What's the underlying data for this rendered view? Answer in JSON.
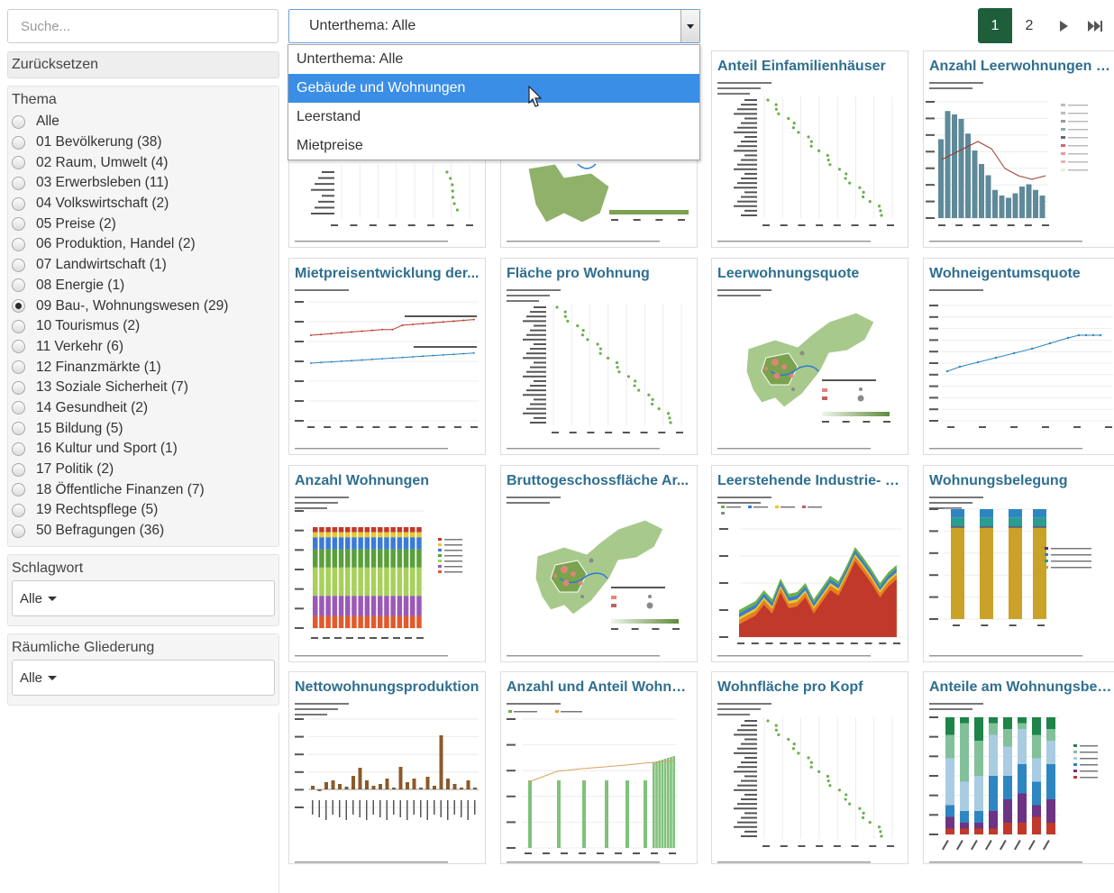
{
  "search": {
    "placeholder": "Suche..."
  },
  "reset_label": "Zurücksetzen",
  "thema": {
    "title": "Thema",
    "options": [
      {
        "label": "Alle",
        "checked": false
      },
      {
        "label": "01 Bevölkerung (38)",
        "checked": false
      },
      {
        "label": "02 Raum, Umwelt (4)",
        "checked": false
      },
      {
        "label": "03 Erwerbsleben (11)",
        "checked": false
      },
      {
        "label": "04 Volkswirtschaft (2)",
        "checked": false
      },
      {
        "label": "05 Preise (2)",
        "checked": false
      },
      {
        "label": "06 Produktion, Handel (2)",
        "checked": false
      },
      {
        "label": "07 Landwirtschaft (1)",
        "checked": false
      },
      {
        "label": "08 Energie (1)",
        "checked": false
      },
      {
        "label": "09 Bau-, Wohnungswesen (29)",
        "checked": true
      },
      {
        "label": "10 Tourismus (2)",
        "checked": false
      },
      {
        "label": "11 Verkehr (6)",
        "checked": false
      },
      {
        "label": "12 Finanzmärkte (1)",
        "checked": false
      },
      {
        "label": "13 Soziale Sicherheit (7)",
        "checked": false
      },
      {
        "label": "14 Gesundheit (2)",
        "checked": false
      },
      {
        "label": "15 Bildung (5)",
        "checked": false
      },
      {
        "label": "16 Kultur und Sport (1)",
        "checked": false
      },
      {
        "label": "17 Politik (2)",
        "checked": false
      },
      {
        "label": "18 Öffentliche Finanzen (7)",
        "checked": false
      },
      {
        "label": "19 Rechtspflege (5)",
        "checked": false
      },
      {
        "label": "50 Befragungen (36)",
        "checked": false
      }
    ]
  },
  "schlagwort": {
    "title": "Schlagwort",
    "value": "Alle"
  },
  "raeumlich": {
    "title": "Räumliche Gliederung",
    "value": "Alle"
  },
  "subthema": {
    "value": "Unterthema: Alle",
    "options": [
      "Unterthema: Alle",
      "Gebäude und Wohnungen",
      "Leerstand",
      "Mietpreise"
    ],
    "highlighted": "Gebäude und Wohnungen"
  },
  "pagination": {
    "pages": [
      "1",
      "2"
    ],
    "current": "1",
    "next": "▶",
    "last": "⏭"
  },
  "cards": [
    {
      "title": "",
      "kind": "dotplot-partial"
    },
    {
      "title": "",
      "kind": "map-partial"
    },
    {
      "title": "Anteil Einfamilienhäuser",
      "kind": "dotplot"
    },
    {
      "title": "Anzahl Leerwohnungen u...",
      "kind": "bar-line"
    },
    {
      "title": "Mietpreisentwicklung der...",
      "kind": "two-lines"
    },
    {
      "title": "Fläche pro Wohnung",
      "kind": "dotplot"
    },
    {
      "title": "Leerwohnungsquote",
      "kind": "map"
    },
    {
      "title": "Wohneigentumsquote",
      "kind": "line"
    },
    {
      "title": "Anzahl Wohnungen",
      "kind": "stacked-bars"
    },
    {
      "title": "Bruttogeschossfläche Ar...",
      "kind": "map"
    },
    {
      "title": "Leerstehende Industrie- u...",
      "kind": "area"
    },
    {
      "title": "Wohnungsbelegung",
      "kind": "stacked-100"
    },
    {
      "title": "Nettowohnungsproduktion",
      "kind": "bars-brown"
    },
    {
      "title": "Anzahl und Anteil Wohnu...",
      "kind": "bars-green-line"
    },
    {
      "title": "Wohnfläche pro Kopf",
      "kind": "dotplot"
    },
    {
      "title": "Anteile am Wohnungsbes...",
      "kind": "stacked-100-multi"
    }
  ],
  "colors": {
    "accent": "#3b8ee5",
    "pager_active": "#1e5e3b",
    "card_title": "#2f6f8f",
    "dot_green": "#6ab04c"
  }
}
